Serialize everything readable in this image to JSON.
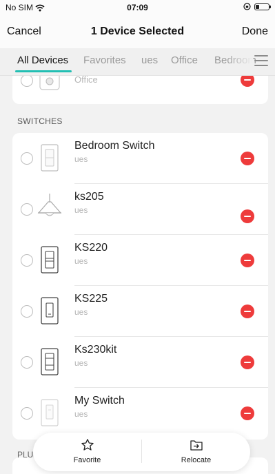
{
  "status_bar": {
    "carrier": "No SIM",
    "time": "07:09"
  },
  "nav": {
    "cancel": "Cancel",
    "title": "1 Device Selected",
    "done": "Done"
  },
  "tabs": [
    "All Devices",
    "Favorites",
    "ues",
    "Office",
    "Bedroom"
  ],
  "active_tab": "All Devices",
  "top_partial_item": {
    "room": "Office"
  },
  "sections": {
    "switches_label": "SWITCHES",
    "next_label": "PLU"
  },
  "devices": [
    {
      "name": "Bedroom Switch",
      "room": "ues",
      "icon": "wall-switch-icon"
    },
    {
      "name": "ks205",
      "room": "ues",
      "icon": "pendant-lamp-icon"
    },
    {
      "name": "KS220",
      "room": "ues",
      "icon": "dimmer-switch-icon"
    },
    {
      "name": "KS225",
      "room": "ues",
      "icon": "smart-dimmer-icon"
    },
    {
      "name": "Ks230kit",
      "room": "ues",
      "icon": "three-way-switch-icon"
    },
    {
      "name": "My Switch",
      "room": "ues",
      "icon": "light-switch-icon"
    }
  ],
  "actions": {
    "favorite": "Favorite",
    "relocate": "Relocate"
  },
  "colors": {
    "accent": "#22bfb3",
    "remove": "#ee3b3b"
  }
}
